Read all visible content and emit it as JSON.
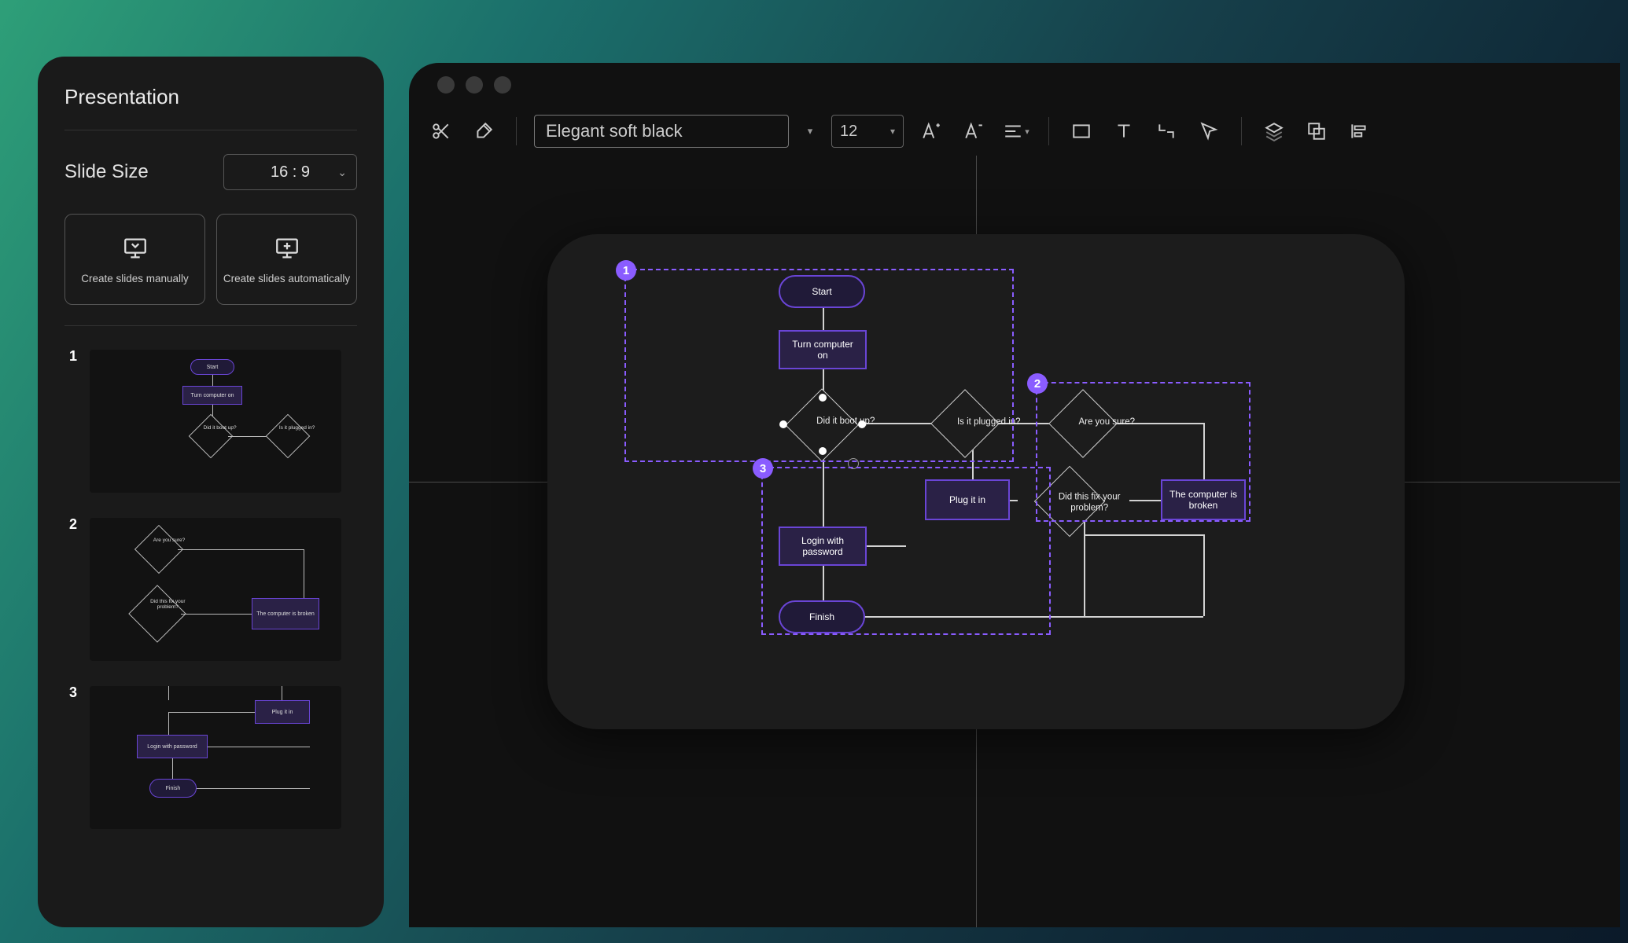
{
  "sidebar": {
    "title": "Presentation",
    "slide_size_label": "Slide Size",
    "slide_size_value": "16 : 9",
    "create_manual": "Create slides manually",
    "create_auto": "Create slides automatically",
    "thumbs": [
      "1",
      "2",
      "3"
    ]
  },
  "toolbar": {
    "font_name": "Elegant soft black",
    "font_size": "12"
  },
  "selections": {
    "s1": "1",
    "s2": "2",
    "s3": "3"
  },
  "flow": {
    "start": "Start",
    "turn_on": "Turn computer on",
    "boot": "Did it boot up?",
    "plugged": "Is it plugged in?",
    "sure": "Are you sure?",
    "plug": "Plug it in",
    "fix": "Did this fix your problem?",
    "broken": "The computer is broken",
    "login": "Login with password",
    "finish": "Finish"
  },
  "thumb1": {
    "a": "Start",
    "b": "Turn computer on",
    "c": "Did it boot up?",
    "d": "Is it plugged in?"
  },
  "thumb2": {
    "a": "Are you sure?",
    "b": "Did this fix your problem?",
    "c": "The computer is broken"
  },
  "thumb3": {
    "a": "Plug it in",
    "b": "Login with password",
    "c": "Finish"
  }
}
